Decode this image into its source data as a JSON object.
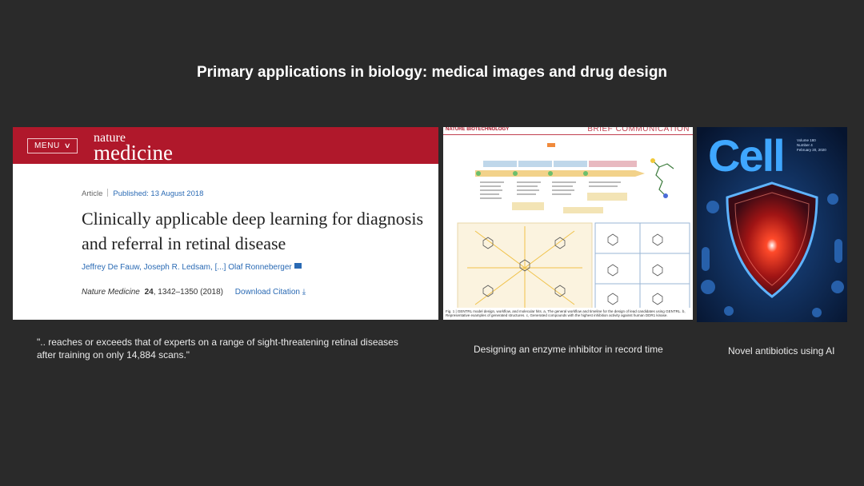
{
  "slide": {
    "title": "Primary applications in biology: medical images and drug design"
  },
  "panel_nature_medicine": {
    "menu_label": "MENU",
    "logo_line1": "nature",
    "logo_line2": "medicine",
    "article_type": "Article",
    "published": "Published: 13 August 2018",
    "title": "Clinically applicable deep learning for diagnosis and referral in retinal disease",
    "authors": "Jeffrey De Fauw, Joseph R. Ledsam, [...] Olaf Ronneberger",
    "citation_journal": "Nature Medicine",
    "citation_volume": "24",
    "citation_rest": ", 1342–1350 (2018)",
    "download_citation": "Download Citation",
    "caption": "\".. reaches or exceeds that of experts on a range of sight-threatening retinal diseases after training on only 14,884 scans.\""
  },
  "panel_nature_biotech": {
    "journal": "NATURE BIOTECHNOLOGY",
    "section": "BRIEF COMMUNICATION",
    "caption": "Designing an enzyme inhibitor in record time",
    "fig_caption": "Fig. 1 | GENTRL model design, workflow, and molecular hits. a, The general workflow and timeline for the design of lead candidates using GENTRL. b, Representative examples of generated structures. c, Generated compounds with the highest inhibition activity against human DDR1 kinase."
  },
  "panel_cell": {
    "logo": "Cell",
    "caption": "Novel antibiotics using AI"
  },
  "colors": {
    "background": "#2a2a2a",
    "nature_red": "#b0182b",
    "link_blue": "#2a6ab4",
    "cell_blue": "#3fa7ff"
  }
}
